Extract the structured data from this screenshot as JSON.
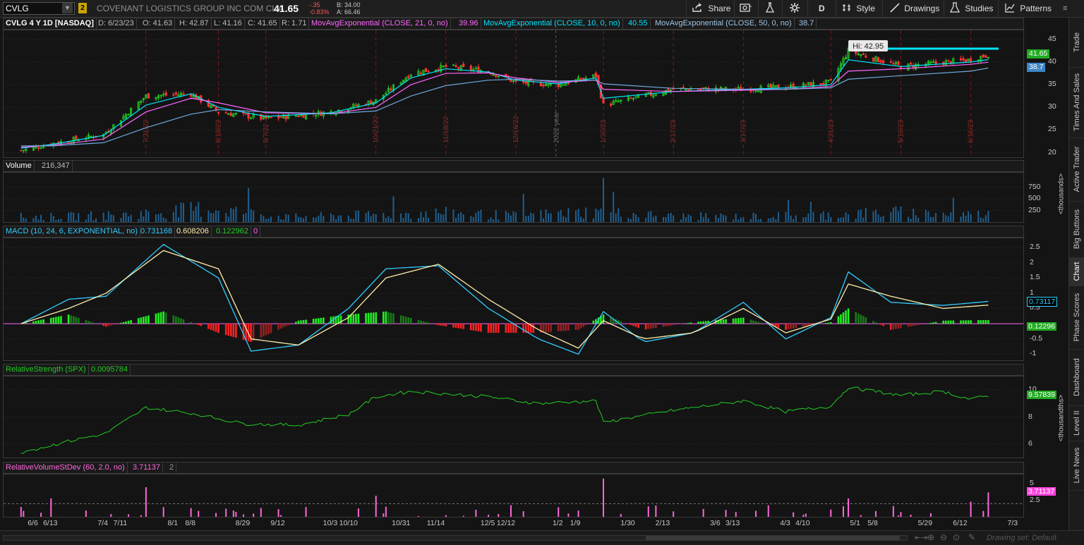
{
  "toolbar": {
    "symbol": "CVLG",
    "link_group": "2",
    "company": "COVENANT LOGISTICS GROUP INC COM CL A",
    "last": "41.65",
    "net_change": "-.35",
    "pct_change": "-0.83%",
    "bid": "B: 34.00",
    "ask": "A: 66.46",
    "share": "Share",
    "aggregation": "D",
    "style": "Style",
    "drawings": "Drawings",
    "studies": "Studies",
    "patterns": "Patterns"
  },
  "price_header": {
    "title": "CVLG 4 Y 1D [NASDAQ]",
    "date": "D: 6/23/23",
    "open": "O: 41.63",
    "high": "H: 42.87",
    "low": "L: 41.16",
    "close": "C: 41.65",
    "range": "R: 1.71",
    "ema21_label": "MovAvgExponential (CLOSE, 21, 0, no)",
    "ema21_value": "39.96",
    "ema10_label": "MovAvgExponential (CLOSE, 10, 0, no)",
    "ema10_value": "40.55",
    "ema50_label": "MovAvgExponential (CLOSE, 50, 0, no)",
    "ema50_value": "38.7"
  },
  "volume_header": {
    "label": "Volume",
    "value": "216,347"
  },
  "macd_header": {
    "label": "MACD (10, 24, 6, EXPONENTIAL, no)",
    "value": "0.731168",
    "avg": "0.608206",
    "diff": "0.122962",
    "zero": "0"
  },
  "rs_header": {
    "label": "RelativeStrength (SPX)",
    "value": "0.0095784"
  },
  "rv_header": {
    "label": "RelativeVolumeStDev (60, 2.0, no)",
    "value": "3.71137",
    "threshold": "2"
  },
  "hi_bubble": "Hi: 42.95",
  "price_axis": [
    "45",
    "40",
    "35",
    "30",
    "25",
    "20"
  ],
  "price_tags": {
    "last": "41.65",
    "ema50": "38.7"
  },
  "volume_axis": [
    "750",
    "500",
    "250"
  ],
  "volume_unit": "<thousands>",
  "macd_axis": [
    "2.5",
    "2",
    "1.5",
    "1",
    "0.5",
    "-0.5",
    "-1"
  ],
  "macd_tags": {
    "value": "0.73117",
    "diff": "0.12296"
  },
  "rs_axis": [
    "10",
    "8",
    "6"
  ],
  "rs_tag": "9.57839",
  "rs_unit": "<thousandths>",
  "rv_axis": [
    "5",
    "2.5"
  ],
  "rv_tag": "3.71137",
  "date_axis": [
    "6/6",
    "6/13",
    "7/4",
    "7/11",
    "8/1",
    "8/8",
    "8/29",
    "9/12",
    "10/3",
    "10/10",
    "10/31",
    "11/14",
    "12/5",
    "12/12",
    "1/2",
    "1/9",
    "1/30",
    "2/13",
    "3/6",
    "3/13",
    "4/3",
    "4/10",
    "5/1",
    "5/8",
    "5/29",
    "6/12",
    "7/3"
  ],
  "earnings_markers": [
    "7/21/22",
    "8/19/22",
    "9/7/22",
    "10/21/22",
    "11/18/22",
    "12/16/22",
    "1/20/23",
    "2/17/23",
    "3/17/23",
    "4/21/23",
    "5/19/23",
    "6/16/23"
  ],
  "year_marker": "2022 year",
  "side_tabs": [
    "Trade",
    "Times And Sales",
    "Active Trader",
    "Big Buttons",
    "Chart",
    "Phase Scores",
    "Dashboard",
    "Level II",
    "Live News"
  ],
  "status": "Drawing set: Default",
  "colors": {
    "up": "#22cc22",
    "down": "#ff3333",
    "ema10": "#00e5ff",
    "ema21": "#ff66ff",
    "ema50": "#6fa8dc",
    "macd": "#33ccff",
    "signal": "#ffeeaa",
    "rs": "#22cc22",
    "rv": "#ff66dd"
  },
  "chart_data": [
    {
      "type": "candlestick",
      "title": "CVLG 4 Y 1D [NASDAQ]",
      "ylim": [
        19,
        47
      ],
      "x": [
        "2022-06-01",
        "2022-06-13",
        "2022-07-04",
        "2022-07-21",
        "2022-08-08",
        "2022-08-19",
        "2022-09-07",
        "2022-10-03",
        "2022-10-21",
        "2022-11-04",
        "2022-11-18",
        "2022-12-05",
        "2022-12-16",
        "2023-01-02",
        "2023-01-17",
        "2023-01-20",
        "2023-02-17",
        "2023-03-17",
        "2023-04-03",
        "2023-04-21",
        "2023-04-28",
        "2023-05-19",
        "2023-06-16",
        "2023-06-23"
      ],
      "close": [
        20.5,
        22,
        24,
        32.5,
        33,
        29,
        27.5,
        29,
        31.5,
        37.5,
        39,
        38,
        35.5,
        35,
        37,
        30.5,
        34,
        34,
        34.5,
        35.5,
        42.5,
        39,
        40.5,
        41.65
      ],
      "series": [
        {
          "name": "MovAvgExponential (CLOSE, 10, 0, no)",
          "values": [
            21,
            21.8,
            23.8,
            30.5,
            33,
            30,
            28,
            28.8,
            31,
            36.5,
            38.5,
            37.8,
            36,
            35.2,
            36.5,
            32,
            33.5,
            34,
            34.3,
            35,
            40.5,
            39,
            40,
            40.55
          ]
        },
        {
          "name": "MovAvgExponential (CLOSE, 21, 0, no)",
          "values": [
            21.2,
            21.6,
            23,
            29,
            32,
            31,
            28.8,
            28.6,
            30,
            35,
            37.5,
            37.6,
            36.5,
            35.5,
            36,
            34,
            33.5,
            33.8,
            34,
            34.6,
            38,
            38.5,
            39.5,
            39.96
          ]
        },
        {
          "name": "MovAvgExponential (CLOSE, 50, 0, no)",
          "values": [
            21.5,
            21.5,
            22.2,
            25.5,
            28.5,
            29.5,
            29,
            28.6,
            29.2,
            32.5,
            34.8,
            36,
            36.2,
            35.8,
            36,
            35.2,
            34.2,
            34,
            34,
            34.3,
            36.2,
            37,
            38,
            38.7
          ]
        }
      ],
      "annotations": [
        "Hi: 42.95"
      ]
    },
    {
      "type": "bar",
      "title": "Volume",
      "ylim": [
        0,
        1000
      ],
      "x": [
        "2022-06",
        "2022-07",
        "2022-08",
        "2022-09",
        "2022-10",
        "2022-11",
        "2022-12",
        "2023-01",
        "2023-02",
        "2023-03",
        "2023-04",
        "2023-05",
        "2023-06"
      ],
      "values": [
        120,
        160,
        300,
        110,
        150,
        200,
        140,
        220,
        130,
        120,
        150,
        210,
        160
      ],
      "peak": {
        "x": "2023-01-20",
        "value": 950
      }
    },
    {
      "type": "line",
      "title": "MACD (10, 24, 6, EXPONENTIAL, no)",
      "ylim": [
        -1.2,
        2.8
      ],
      "x": [
        "2022-06-01",
        "2022-06-20",
        "2022-07-05",
        "2022-07-28",
        "2022-08-19",
        "2022-09-01",
        "2022-09-20",
        "2022-10-10",
        "2022-10-25",
        "2022-11-15",
        "2022-12-05",
        "2022-12-25",
        "2023-01-10",
        "2023-01-20",
        "2023-02-05",
        "2023-02-25",
        "2023-03-17",
        "2023-04-03",
        "2023-04-21",
        "2023-04-28",
        "2023-05-15",
        "2023-06-05",
        "2023-06-23"
      ],
      "series": [
        {
          "name": "Value",
          "values": [
            0,
            0.8,
            0.9,
            2.6,
            1.5,
            -0.9,
            -0.7,
            0.5,
            1.8,
            1.9,
            0.5,
            -0.5,
            -1.0,
            0.4,
            -0.6,
            -0.3,
            0.7,
            -0.5,
            0.2,
            1.7,
            0.7,
            0.6,
            0.73
          ]
        },
        {
          "name": "Avg",
          "values": [
            0,
            0.5,
            1.0,
            2.4,
            1.8,
            -0.5,
            -0.7,
            0.2,
            1.5,
            1.95,
            0.8,
            -0.2,
            -0.8,
            0.1,
            -0.5,
            -0.3,
            0.5,
            -0.3,
            0.15,
            1.3,
            0.9,
            0.5,
            0.61
          ]
        },
        {
          "name": "Diff",
          "values": [
            0,
            0.3,
            -0.1,
            0.4,
            -0.3,
            -0.6,
            0.1,
            0.3,
            0.4,
            -0.05,
            -0.3,
            -0.3,
            -0.2,
            0.3,
            -0.2,
            0.05,
            0.2,
            -0.2,
            0.05,
            0.5,
            -0.2,
            0.1,
            0.12
          ]
        }
      ]
    },
    {
      "type": "line",
      "title": "RelativeStrength (SPX)",
      "ylim": [
        5,
        11
      ],
      "x": [
        "2022-06-01",
        "2022-06-20",
        "2022-07-05",
        "2022-07-21",
        "2022-08-08",
        "2022-08-29",
        "2022-09-20",
        "2022-10-10",
        "2022-10-21",
        "2022-11-04",
        "2022-12-05",
        "2022-12-25",
        "2023-01-17",
        "2023-01-20",
        "2023-02-17",
        "2023-03-17",
        "2023-04-03",
        "2023-04-21",
        "2023-04-28",
        "2023-05-19",
        "2023-06-05",
        "2023-06-16",
        "2023-06-23"
      ],
      "series": [
        {
          "name": "RelativeStrength (SPX)",
          "values": [
            5.4,
            6.2,
            6.8,
            8.7,
            8.3,
            7.5,
            7.4,
            8.2,
            9.5,
            9.9,
            9.5,
            9.0,
            9.2,
            7.6,
            8.5,
            9.2,
            8.4,
            8.8,
            10.2,
            9.6,
            9.9,
            9.3,
            9.58
          ]
        }
      ]
    },
    {
      "type": "bar",
      "title": "RelativeVolumeStDev (60, 2.0, no)",
      "ylim": [
        0,
        6
      ],
      "x": [
        "2022-06-01",
        "2022-06-13",
        "2022-07-21",
        "2022-10-21",
        "2023-01-20",
        "2023-04-28",
        "2023-06-16",
        "2023-06-23"
      ],
      "values": [
        1.5,
        2.8,
        4.5,
        3.2,
        5.8,
        2.8,
        2.3,
        3.71
      ],
      "threshold": 2
    }
  ]
}
